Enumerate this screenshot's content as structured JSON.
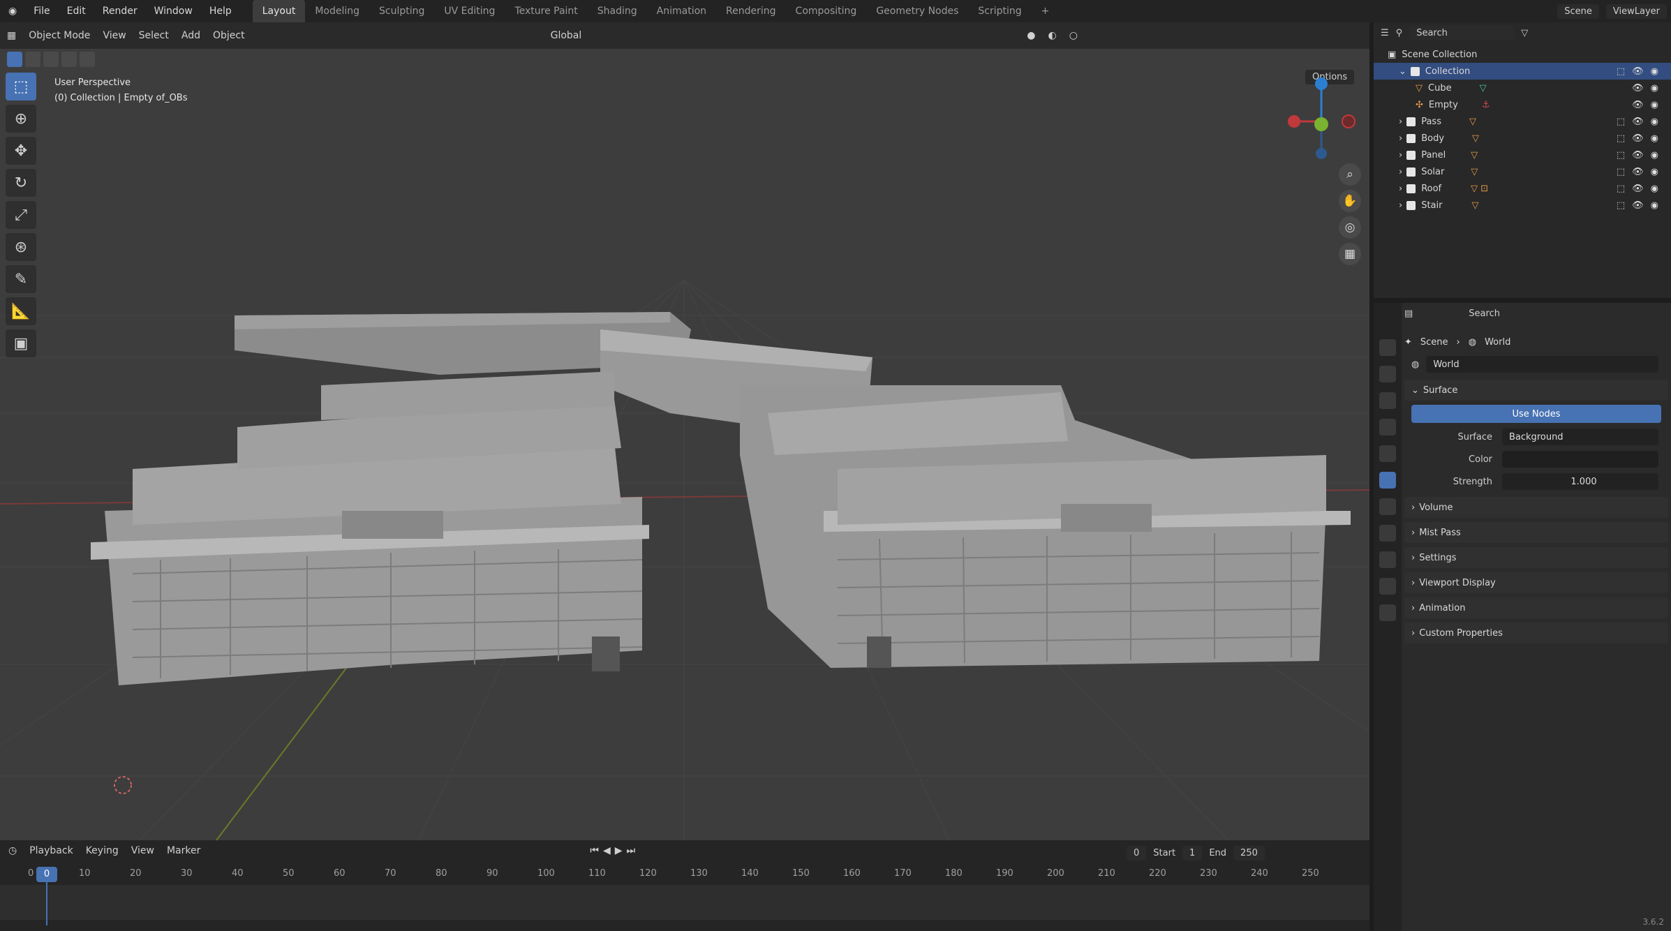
{
  "topbar": {
    "menus": [
      "File",
      "Edit",
      "Render",
      "Window",
      "Help"
    ],
    "workspaces": [
      "Layout",
      "Modeling",
      "Sculpting",
      "UV Editing",
      "Texture Paint",
      "Shading",
      "Animation",
      "Rendering",
      "Compositing",
      "Geometry Nodes",
      "Scripting"
    ],
    "active_workspace": "Layout",
    "scene": "Scene",
    "view_layer": "ViewLayer"
  },
  "viewport": {
    "mode": "Object Mode",
    "menus": [
      "View",
      "Select",
      "Add",
      "Object"
    ],
    "transform_orientation": "Global",
    "options_label": "Options",
    "info_line1": "User Perspective",
    "info_line2": "(0) Collection | Empty of_OBs"
  },
  "timeline": {
    "menus": [
      "Playback",
      "Keying",
      "View",
      "Marker"
    ],
    "current_frame": "0",
    "start_label": "Start",
    "start_value": "1",
    "end_label": "End",
    "end_value": "250",
    "ruler": [
      "0",
      "10",
      "20",
      "30",
      "40",
      "50",
      "60",
      "70",
      "80",
      "90",
      "100",
      "110",
      "120",
      "130",
      "140",
      "150",
      "160",
      "170",
      "180",
      "190",
      "200",
      "210",
      "220",
      "230",
      "240",
      "250"
    ]
  },
  "outliner": {
    "search_placeholder": "Search",
    "items": [
      {
        "name": "Scene Collection"
      },
      {
        "name": "Collection"
      },
      {
        "name": "Cube"
      },
      {
        "name": "Empty"
      },
      {
        "name": "Pass"
      },
      {
        "name": "Body"
      },
      {
        "name": "Panel"
      },
      {
        "name": "Solar"
      },
      {
        "name": "Roof"
      },
      {
        "name": "Stair"
      }
    ]
  },
  "properties": {
    "search_placeholder": "Search",
    "breadcrumb_scene": "Scene",
    "breadcrumb_world": "World",
    "world_name": "World",
    "surface_panel": "Surface",
    "use_nodes": "Use Nodes",
    "surface_label": "Surface",
    "surface_value": "Background",
    "color_label": "Color",
    "strength_label": "Strength",
    "strength_value": "1.000",
    "panels": [
      "Volume",
      "Mist Pass",
      "Settings",
      "Viewport Display",
      "Animation",
      "Custom Properties"
    ]
  },
  "statusbar": {
    "version": "3.6.2"
  }
}
